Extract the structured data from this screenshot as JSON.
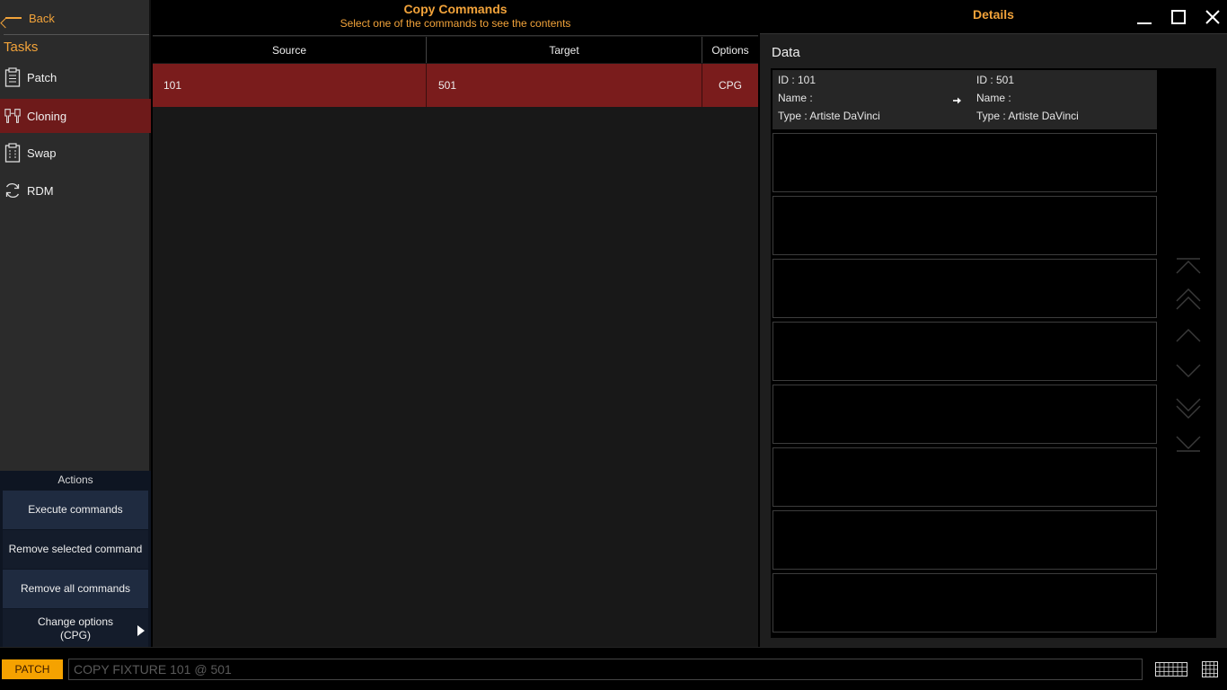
{
  "sidebar": {
    "back_label": "Back",
    "tasks_label": "Tasks",
    "items": [
      {
        "label": "Patch",
        "icon": "clipboard-icon",
        "active": false
      },
      {
        "label": "Cloning",
        "icon": "clone-icon",
        "active": true
      },
      {
        "label": "Swap",
        "icon": "swap-icon",
        "active": false
      },
      {
        "label": "RDM",
        "icon": "refresh-icon",
        "active": false
      }
    ]
  },
  "actions": {
    "title": "Actions",
    "execute": "Execute commands",
    "remove_selected": "Remove selected command",
    "remove_all": "Remove all commands",
    "change_options": "Change options",
    "change_options_value": "(CPG)"
  },
  "copy_commands": {
    "title": "Copy Commands",
    "subtitle": "Select one of the commands to see the contents",
    "columns": [
      "Source",
      "Target",
      "Options"
    ],
    "rows": [
      {
        "source": "101",
        "target": "501",
        "options": "CPG",
        "selected": true
      }
    ]
  },
  "details": {
    "title": "Details",
    "data_label": "Data",
    "source": {
      "id": "ID : 101",
      "name": "Name :",
      "type": "Type : Artiste DaVinci"
    },
    "target": {
      "id": "ID : 501",
      "name": "Name :",
      "type": "Type : Artiste DaVinci"
    }
  },
  "command_line": {
    "mode": "PATCH",
    "placeholder": "COPY FIXTURE 101 @ 501"
  },
  "colors": {
    "accent": "#f2a33a",
    "selected_row": "#7a1c1c",
    "mode_button": "#f5a200"
  }
}
